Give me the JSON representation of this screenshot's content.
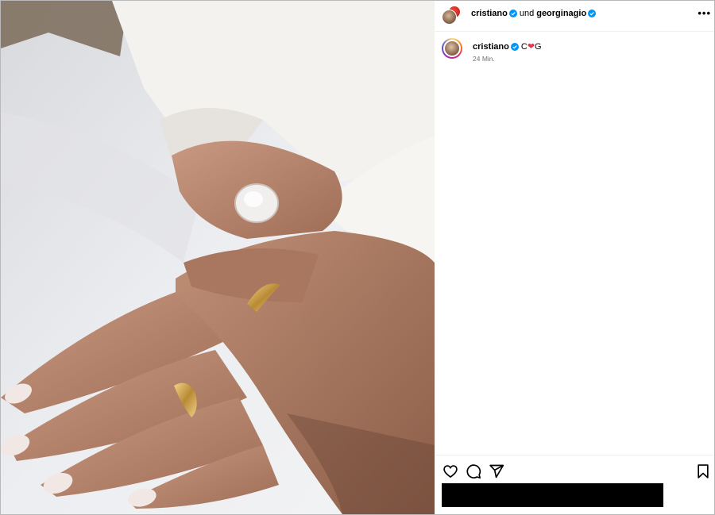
{
  "post": {
    "photo_alt": "photo",
    "header": {
      "author": "cristiano",
      "joiner": "und",
      "collaborator": "georginagio",
      "more": "•••"
    },
    "caption": {
      "username": "cristiano",
      "text_before": "C",
      "heart": "❤",
      "text_after": "G",
      "timestamp": "24 Min."
    },
    "actions": {
      "like": "heart-icon",
      "comment": "comment-icon",
      "share": "share-icon",
      "save": "bookmark-icon"
    }
  },
  "colors": {
    "verified": "#0095f6",
    "heart": "#e3344d",
    "timestamp": "#737373"
  }
}
